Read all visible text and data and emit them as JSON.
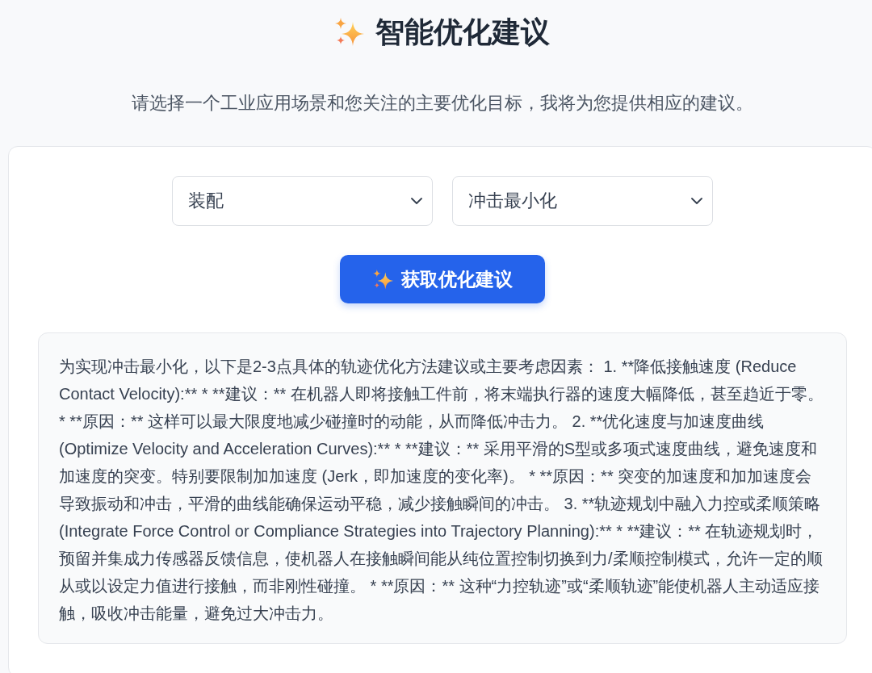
{
  "header": {
    "title": "智能优化建议",
    "subtitle": "请选择一个工业应用场景和您关注的主要优化目标，我将为您提供相应的建议。"
  },
  "controls": {
    "dropdowns": [
      {
        "value": "装配"
      },
      {
        "value": "冲击最小化"
      }
    ],
    "submit_button": {
      "label": "获取优化建议"
    }
  },
  "result": {
    "text": "为实现冲击最小化，以下是2-3点具体的轨迹优化方法建议或主要考虑因素： 1. **降低接触速度 (Reduce Contact Velocity):** * **建议：** 在机器人即将接触工件前，将末端执行器的速度大幅降低，甚至趋近于零。 * **原因：** 这样可以最大限度地减少碰撞时的动能，从而降低冲击力。 2. **优化速度与加速度曲线 (Optimize Velocity and Acceleration Curves):** * **建议：** 采用平滑的S型或多项式速度曲线，避免速度和加速度的突变。特别要限制加加速度 (Jerk，即加速度的变化率)。 * **原因：** 突变的加速度和加加速度会导致振动和冲击，平滑的曲线能确保运动平稳，减少接触瞬间的冲击。 3. **轨迹规划中融入力控或柔顺策略 (Integrate Force Control or Compliance Strategies into Trajectory Planning):** * **建议：** 在轨迹规划时，预留并集成力传感器反馈信息，使机器人在接触瞬间能从纯位置控制切换到力/柔顺控制模式，允许一定的顺从或以设定力值进行接触，而非刚性碰撞。 * **原因：** 这种“力控轨迹”或“柔顺轨迹”能使机器人主动适应接触，吸收冲击能量，避免过大冲击力。"
  }
}
